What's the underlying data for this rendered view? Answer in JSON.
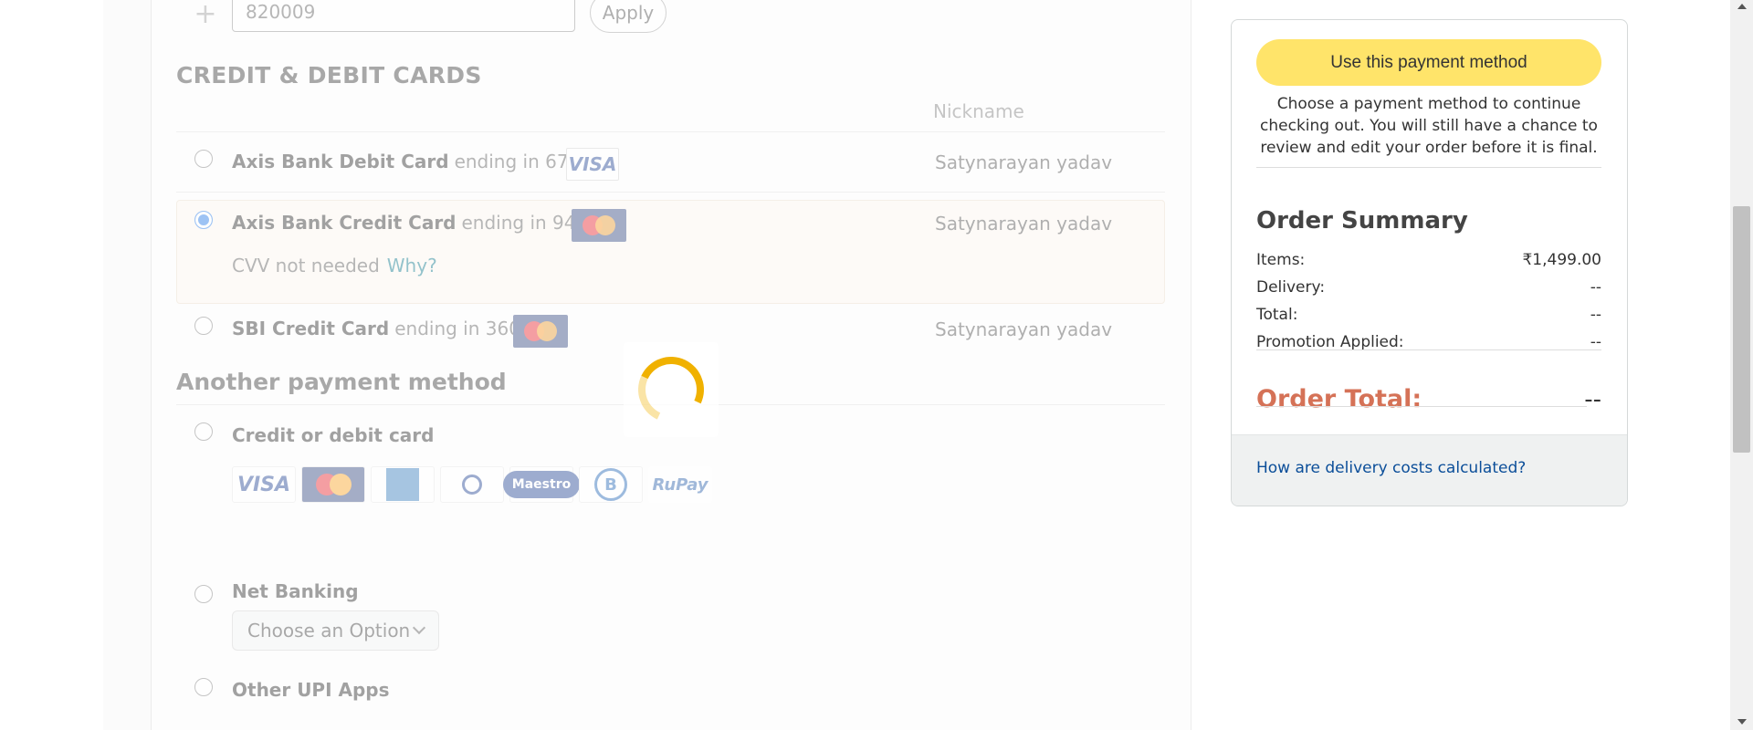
{
  "promo": {
    "value": "820009",
    "apply_label": "Apply",
    "plus_icon": "plus-icon"
  },
  "cards_section": {
    "title": "CREDIT & DEBIT CARDS",
    "nickname_header": "Nickname",
    "cards": [
      {
        "bank": "Axis Bank Debit Card",
        "ending": "ending in 6743",
        "network": "VISA",
        "nickname": "Satynarayan yadav",
        "selected": false
      },
      {
        "bank": "Axis Bank Credit Card",
        "ending": "ending in 9459",
        "network": "MasterCard",
        "nickname": "Satynarayan yadav",
        "selected": true
      },
      {
        "bank": "SBI Credit Card",
        "ending": "ending in 3607",
        "network": "MasterCard",
        "nickname": "Satynarayan yadav",
        "selected": false
      }
    ],
    "cvv_text": "CVV not needed",
    "cvv_why": "Why?"
  },
  "another_section": {
    "title": "Another payment method",
    "credit_debit_label": "Credit or debit card",
    "logos": [
      "VISA",
      "MasterCard",
      "American Express",
      "Diners Club International",
      "Maestro",
      "Bajaj Finserv",
      "RuPay"
    ],
    "netbanking_label": "Net Banking",
    "netbanking_select": "Choose an Option",
    "upi_label": "Other UPI Apps"
  },
  "summary": {
    "use_button": "Use this payment method",
    "note": "Choose a payment method to continue checking out. You will still have a chance to review and edit your order before it is final.",
    "title": "Order Summary",
    "items_label": "Items:",
    "items_value": "₹1,499.00",
    "delivery_label": "Delivery:",
    "delivery_value": "--",
    "total_label": "Total:",
    "total_value": "--",
    "promo_label": "Promotion Applied:",
    "promo_value": "--",
    "order_total_label": "Order Total:",
    "order_total_value": "--",
    "delivery_link": "How are delivery costs calculated?"
  },
  "colors": {
    "accent_button": "#ffe46a",
    "order_total": "#c7441f",
    "link": "#0b4e99",
    "spinner": "#f0b100"
  }
}
